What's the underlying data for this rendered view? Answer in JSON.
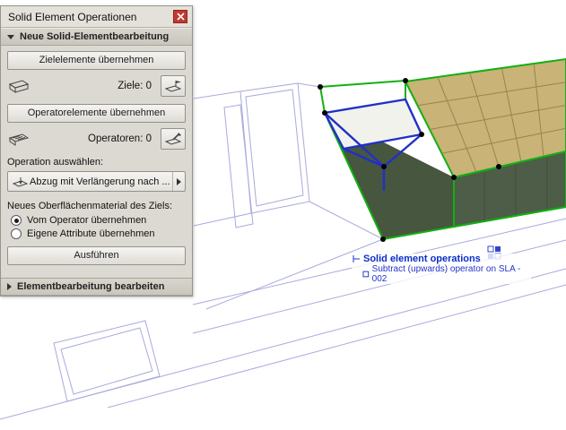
{
  "panel": {
    "title": "Solid Element Operationen",
    "section_new": "Neue Solid-Elementbearbeitung",
    "btn_targets": "Zielelemente übernehmen",
    "targets_count": "Ziele: 0",
    "btn_operators": "Operatorelemente übernehmen",
    "operators_count": "Operatoren: 0",
    "operation_label": "Operation auswählen:",
    "operation_value": "Abzug mit Verlängerung nach ...",
    "material_label": "Neues Oberflächenmaterial des Ziels:",
    "radio_from_operator": "Vom Operator übernehmen",
    "radio_own_attributes": "Eigene Attribute übernehmen",
    "btn_execute": "Ausführen",
    "section_edit": "Elementbearbeitung bearbeiten"
  },
  "tooltip": {
    "title": "Solid element operations",
    "detail": "Subtract (upwards) operator on SLA - 002"
  },
  "colors": {
    "selection_green": "#12b012",
    "operator_blue": "#2030c8",
    "tooltip_blue": "#0a2ec8",
    "wireframe": "#a9a9dd",
    "deck_tan": "#c9b377",
    "deck_side": "#4e5d48"
  }
}
